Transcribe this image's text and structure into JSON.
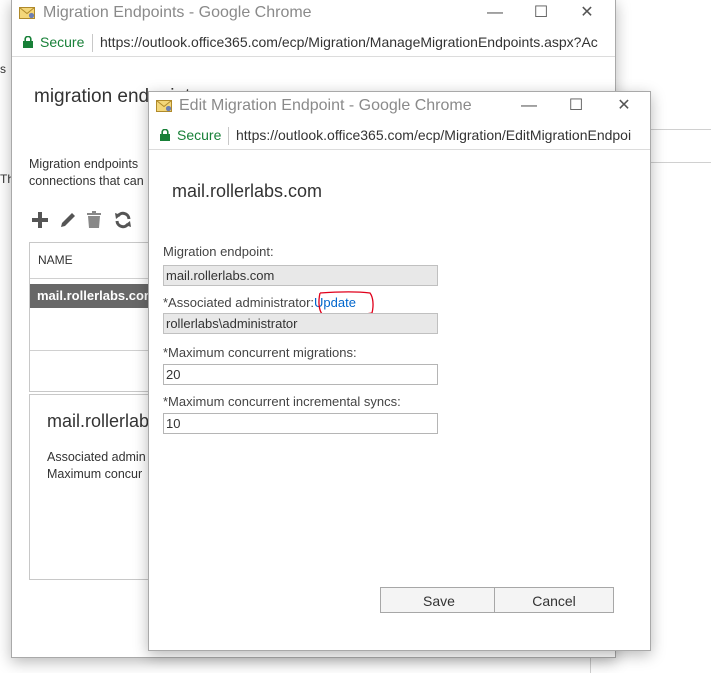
{
  "main_window": {
    "title": "Migration Endpoints - Google Chrome",
    "controls": {
      "minimize": "—",
      "maximize": "☐",
      "close": "✕"
    },
    "secure_label": "Secure",
    "url": "https://outlook.office365.com/ecp/Migration/ManageMigrationEndpoints.aspx?Ac",
    "heading": "migration endpoint",
    "description_line1": "Migration endpoints",
    "description_line2": "connections that can",
    "column_name": "NAME",
    "selected_row": "mail.rollerlabs.com",
    "detail_title": "mail.rollerlab",
    "detail_line1": "Associated admin",
    "detail_line2": "Maximum concur",
    "toolbar_icons": [
      "add-icon",
      "edit-icon",
      "delete-icon",
      "refresh-icon"
    ]
  },
  "background_page": {
    "sliver_text_1": "s",
    "sliver_text_2": "Th"
  },
  "edit_dialog": {
    "title": "Edit Migration Endpoint - Google Chrome",
    "controls": {
      "minimize": "—",
      "maximize": "☐",
      "close": "✕"
    },
    "secure_label": "Secure",
    "url": "https://outlook.office365.com/ecp/Migration/EditMigrationEndpoi",
    "heading": "mail.rollerlabs.com",
    "endpoint_label": "Migration endpoint:",
    "endpoint_value": "mail.rollerlabs.com",
    "admin_label": "*Associated administrator:",
    "admin_update_link": "Update",
    "admin_value": "rollerlabs\\administrator",
    "max_concurrent_label": "*Maximum concurrent migrations:",
    "max_concurrent_value": "20",
    "max_incremental_label": "*Maximum concurrent incremental syncs:",
    "max_incremental_value": "10",
    "save_label": "Save",
    "cancel_label": "Cancel"
  },
  "colors": {
    "secure_green": "#188038",
    "link_blue": "#0066cc",
    "annotation_red": "#e0001b",
    "selected_row_bg": "#686868"
  }
}
